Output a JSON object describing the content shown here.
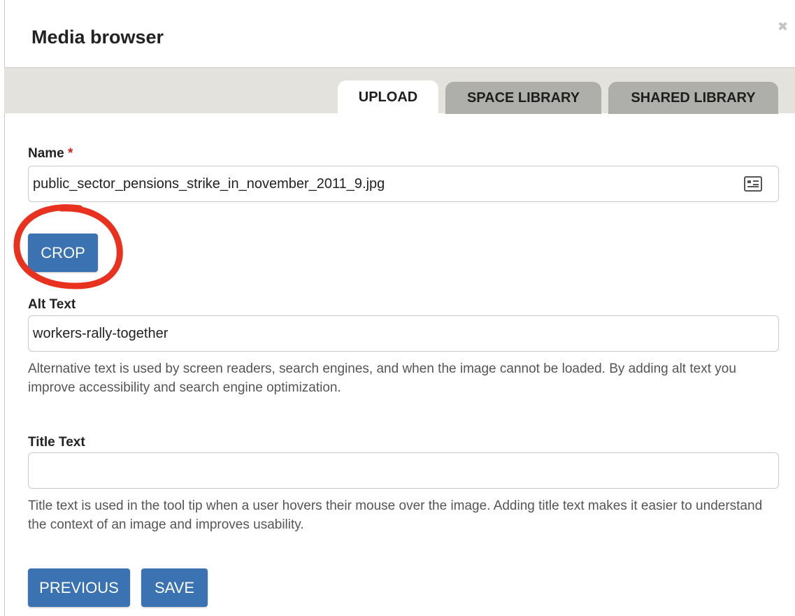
{
  "dialog": {
    "title": "Media browser",
    "close_icon": "close-icon"
  },
  "tabs": [
    {
      "label": "UPLOAD",
      "active": true
    },
    {
      "label": "SPACE LIBRARY",
      "active": false
    },
    {
      "label": "SHARED LIBRARY",
      "active": false
    }
  ],
  "name_field": {
    "label": "Name",
    "required_marker": "*",
    "value": "public_sector_pensions_strike_in_november_2011_9.jpg",
    "icon": "contact-card-icon"
  },
  "crop_button": {
    "label": "CROP"
  },
  "alt_field": {
    "label": "Alt Text",
    "value": "workers-rally-together",
    "help": "Alternative text is used by screen readers, search engines, and when the image cannot be loaded. By adding alt text you improve accessibility and search engine optimization."
  },
  "title_field": {
    "label": "Title Text",
    "value": "",
    "help": "Title text is used in the tool tip when a user hovers their mouse over the image. Adding title text makes it easier to understand the context of an image and improves usability."
  },
  "footer": {
    "previous_label": "PREVIOUS",
    "save_label": "SAVE"
  },
  "colors": {
    "button": "#3a72b2",
    "tab_bar": "#e3e2dd",
    "tab_inactive": "#aeaeab",
    "annotation": "#e8321f",
    "required": "#cc2222"
  }
}
